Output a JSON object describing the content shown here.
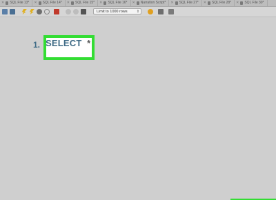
{
  "tabs": [
    {
      "label": "SQL File 13*"
    },
    {
      "label": "SQL File 14*"
    },
    {
      "label": "SQL File 15*"
    },
    {
      "label": "SQL File 16*"
    },
    {
      "label": "Narration Script*"
    },
    {
      "label": "SQL File 27*"
    },
    {
      "label": "SQL File 28*"
    },
    {
      "label": "SQL File 30*"
    }
  ],
  "toolbar": {
    "limit_select_value": "Limit to 1000 rows",
    "icons": [
      "folder-icon",
      "save-icon",
      "execute-icon",
      "execute-current-icon",
      "explain-icon",
      "stop-icon",
      "error-toggle-icon",
      "commit-icon",
      "rollback-icon",
      "autocommit-icon",
      "beautify-icon",
      "find-icon",
      "invisible-chars-icon"
    ]
  },
  "editor": {
    "line_number": "1.",
    "keyword": "SELECT",
    "operator": "*"
  },
  "colors": {
    "highlight_border": "#33dd33",
    "keyword": "#3f6b86"
  }
}
